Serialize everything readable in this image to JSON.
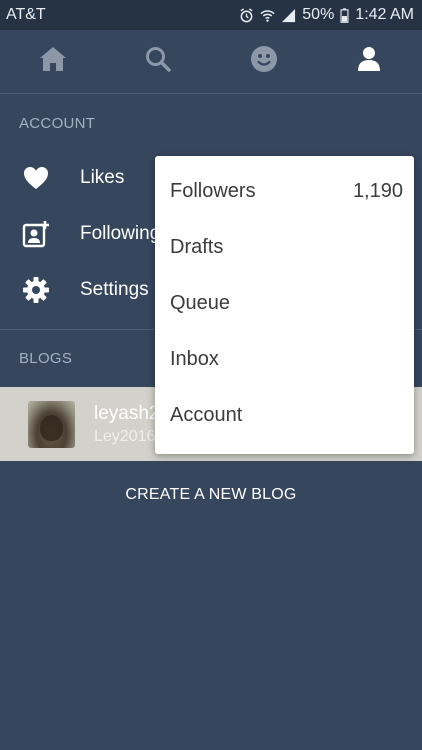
{
  "status_bar": {
    "carrier": "AT&T",
    "battery": "50%",
    "time": "1:42 AM"
  },
  "tabs": [
    {
      "name": "home",
      "icon": "home-icon"
    },
    {
      "name": "search",
      "icon": "search-icon"
    },
    {
      "name": "activity",
      "icon": "smiley-icon"
    },
    {
      "name": "account",
      "icon": "person-icon"
    }
  ],
  "account_section": {
    "title": "ACCOUNT",
    "items": [
      {
        "label": "Likes",
        "icon": "heart-icon"
      },
      {
        "label": "Following",
        "icon": "add-person-icon"
      },
      {
        "label": "Settings",
        "icon": "gear-icon"
      }
    ]
  },
  "blogs_section": {
    "title": "BLOGS",
    "blog": {
      "name": "leyash2",
      "subtitle": "Ley2016"
    },
    "create_label": "CREATE A NEW BLOG"
  },
  "dropdown": {
    "items": [
      {
        "label": "Followers",
        "count": "1,190"
      },
      {
        "label": "Drafts",
        "count": ""
      },
      {
        "label": "Queue",
        "count": ""
      },
      {
        "label": "Inbox",
        "count": ""
      },
      {
        "label": "Account",
        "count": ""
      }
    ]
  },
  "colors": {
    "background": "#36465d",
    "status_bar": "#263345",
    "blog_row": "#d2d1ca",
    "tab_inactive": "#8c98a8",
    "tab_active": "#ffffff"
  }
}
